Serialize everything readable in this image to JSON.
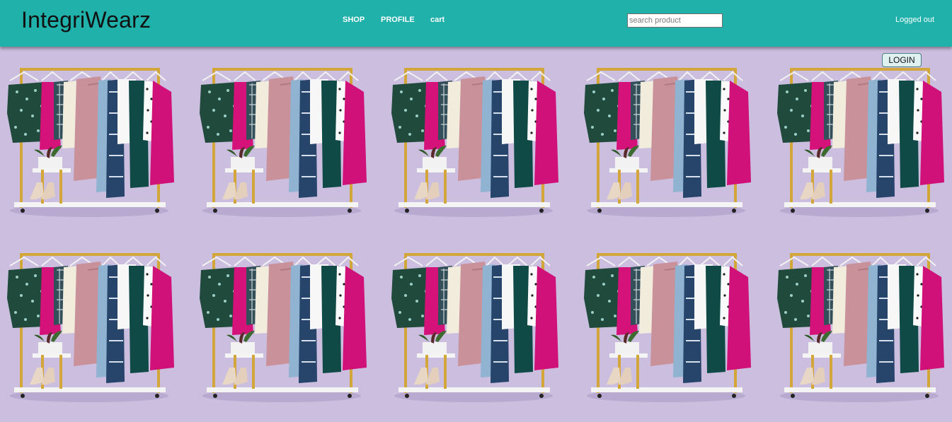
{
  "header": {
    "brand": "IntegriWearz",
    "nav": [
      "SHOP",
      "PROFILE",
      "cart"
    ],
    "search_placeholder": "search product",
    "status": "Logged out",
    "login_label": "LOGIN"
  },
  "products": [
    {
      "image": "clothing-rack-image"
    },
    {
      "image": "clothing-rack-image"
    },
    {
      "image": "clothing-rack-image"
    },
    {
      "image": "clothing-rack-image"
    },
    {
      "image": "clothing-rack-image"
    },
    {
      "image": "clothing-rack-image"
    },
    {
      "image": "clothing-rack-image"
    },
    {
      "image": "clothing-rack-image"
    },
    {
      "image": "clothing-rack-image"
    },
    {
      "image": "clothing-rack-image"
    }
  ]
}
